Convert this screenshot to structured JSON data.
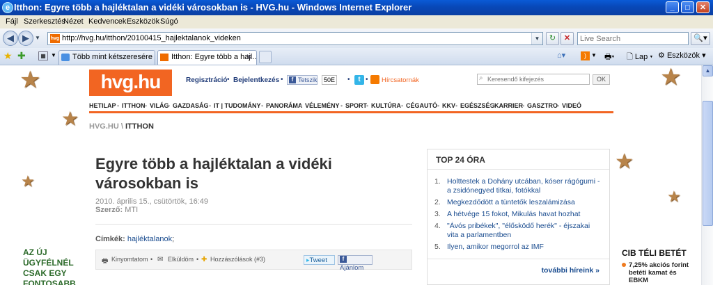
{
  "window": {
    "title": "Itthon: Egyre több a hajléktalan a vidéki városokban is - HVG.hu - Windows Internet Explorer"
  },
  "menubar": [
    "Fájl",
    "Szerkesztés",
    "Nézet",
    "Kedvencek",
    "Eszközök",
    "Súgó"
  ],
  "address": {
    "url": "http://hvg.hu/itthon/20100415_hajlektalanok_videken",
    "search_placeholder": "Live Search"
  },
  "tabs": [
    {
      "label": "Több mint kétszeresére nőtt ..."
    },
    {
      "label": "Itthon: Egyre több a hajl..."
    }
  ],
  "toolbar": {
    "page_label": "Lap",
    "tools_label": "Eszközök"
  },
  "site": {
    "logo": "hvg.hu",
    "register": "Regisztráció",
    "login": "Bejelentkezés",
    "like": "Tetszik",
    "like_count": "50E",
    "feeds": "Hírcsatornák",
    "search_placeholder": "Keresendő kifejezés",
    "ok": "OK",
    "nav": [
      "HETILAP",
      "ITTHON",
      "VILÁG",
      "GAZDASÁG",
      "IT | TUDOMÁNY",
      "PANORÁMA",
      "VÉLEMÉNY",
      "SPORT",
      "KULTÚRA",
      "CÉGAUTÓ",
      "KKV",
      "EGÉSZSÉG",
      "KARRIER",
      "GASZTRO",
      "VIDEÓ"
    ],
    "breadcrumb_root": "HVG.HU",
    "breadcrumb_sep": "\\",
    "breadcrumb_section": "ITTHON"
  },
  "article": {
    "headline": "Egyre több a hajléktalan a vidéki városokban is",
    "date": "2010. április 15., csütörtök, 16:49",
    "author_label": "Szerző:",
    "author": "MTI",
    "tags_label": "Címkék:",
    "tag": "hajléktalanok",
    "tag_suffix": ";",
    "print": "Kinyomtatom",
    "send": "Elküldöm",
    "comments": "Hozzászólások (#3)",
    "tweet": "Tweet",
    "recommend": "Ajánlom"
  },
  "top24": {
    "title": "TOP 24 ÓRA",
    "items": [
      {
        "n": "1.",
        "text": "Holttestek a Dohány utcában, kóser rágógumi - a zsidónegyed titkai, fotókkal"
      },
      {
        "n": "2.",
        "text": "Megkezdődött a tüntetők leszalámizása"
      },
      {
        "n": "3.",
        "text": "A hétvége 15 fokot, Mikulás havat hozhat"
      },
      {
        "n": "4.",
        "text": "\"Ávós pribékek\", \"élősködő herék\" - éjszakai vita a parlamentben"
      },
      {
        "n": "5.",
        "text": "Ilyen, amikor megorrol az IMF"
      }
    ],
    "more": "további híreink »"
  },
  "promo_left": [
    "AZ ÚJ",
    "ÜGYFÉLNÉL",
    "CSAK EGY",
    "FONTOSABB"
  ],
  "promo_right": {
    "title": "CIB TÉLI BETÉT",
    "bullet": "7,25% akciós forint betéti kamat és EBKM"
  }
}
